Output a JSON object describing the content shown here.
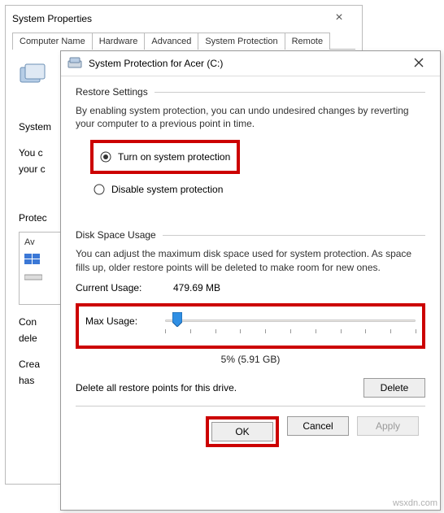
{
  "sysprops": {
    "title": "System Properties",
    "tabs": [
      "Computer Name",
      "Hardware",
      "Advanced",
      "System Protection",
      "Remote"
    ],
    "line1": "System",
    "line2": "You c",
    "line3": "your c",
    "protect_label": "Protec",
    "drive_header": "Av",
    "config_line1": "Con",
    "config_line2": "dele",
    "create_line1": "Crea",
    "create_line2": "has"
  },
  "dialog": {
    "title": "System Protection for Acer (C:)",
    "restore_section": "Restore Settings",
    "restore_desc": "By enabling system protection, you can undo undesired changes by reverting your computer to a previous point in time.",
    "radio_on": "Turn on system protection",
    "radio_off": "Disable system protection",
    "disk_section": "Disk Space Usage",
    "disk_desc": "You can adjust the maximum disk space used for system protection. As space fills up, older restore points will be deleted to make room for new ones.",
    "current_usage_label": "Current Usage:",
    "current_usage_value": "479.69 MB",
    "max_usage_label": "Max Usage:",
    "slider_percent": 5,
    "slider_caption": "5% (5.91 GB)",
    "delete_desc": "Delete all restore points for this drive.",
    "delete_btn": "Delete",
    "ok_btn": "OK",
    "cancel_btn": "Cancel",
    "apply_btn": "Apply"
  },
  "watermark": "wsxdn.com"
}
